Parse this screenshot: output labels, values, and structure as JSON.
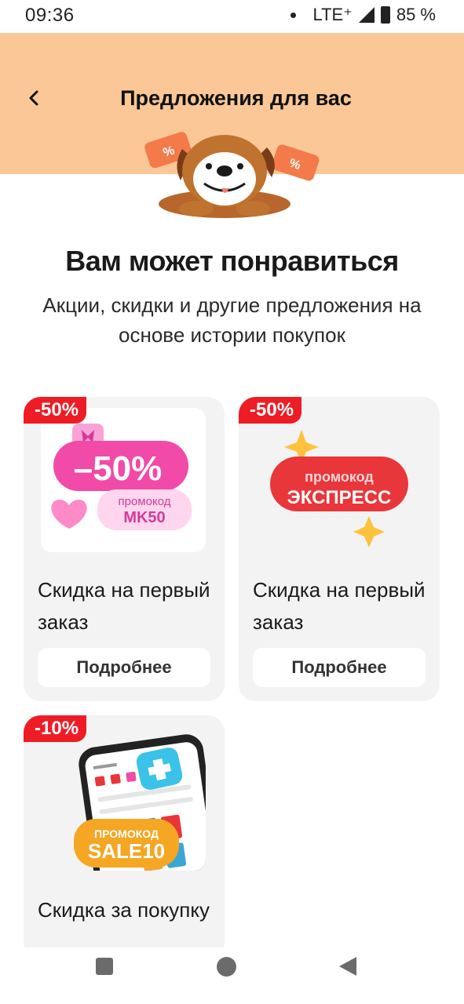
{
  "status_bar": {
    "time": "09:36",
    "network": "LTE⁺",
    "battery": "85 %"
  },
  "header": {
    "title": "Предложения для вас",
    "background": "#fbc796"
  },
  "main": {
    "heading": "Вам может понравиться",
    "subheading": "Акции, скидки и другие предложения на основе истории покупок"
  },
  "offers": [
    {
      "badge": "-50%",
      "image_text_big": "–50%",
      "image_promo_label": "промокод",
      "image_promo_code": "MK50",
      "title": "Скидка на первый заказ",
      "button": "Подробнее"
    },
    {
      "badge": "-50%",
      "image_promo_label": "промокод",
      "image_promo_code": "ЭКСПРЕСС",
      "title": "Скидка на первый заказ",
      "button": "Подробнее"
    },
    {
      "badge": "-10%",
      "image_promo_label": "ПРОМОКОД",
      "image_promo_code": "SALE10",
      "title": "Скидка за покупку"
    }
  ],
  "colors": {
    "accent_red": "#ee1c25",
    "header_peach": "#fbc796",
    "card_bg": "#f3f3f3"
  },
  "icons": [
    "back-arrow-icon",
    "signal-icon",
    "battery-icon",
    "nav-recents-icon",
    "nav-home-icon",
    "nav-back-icon"
  ]
}
